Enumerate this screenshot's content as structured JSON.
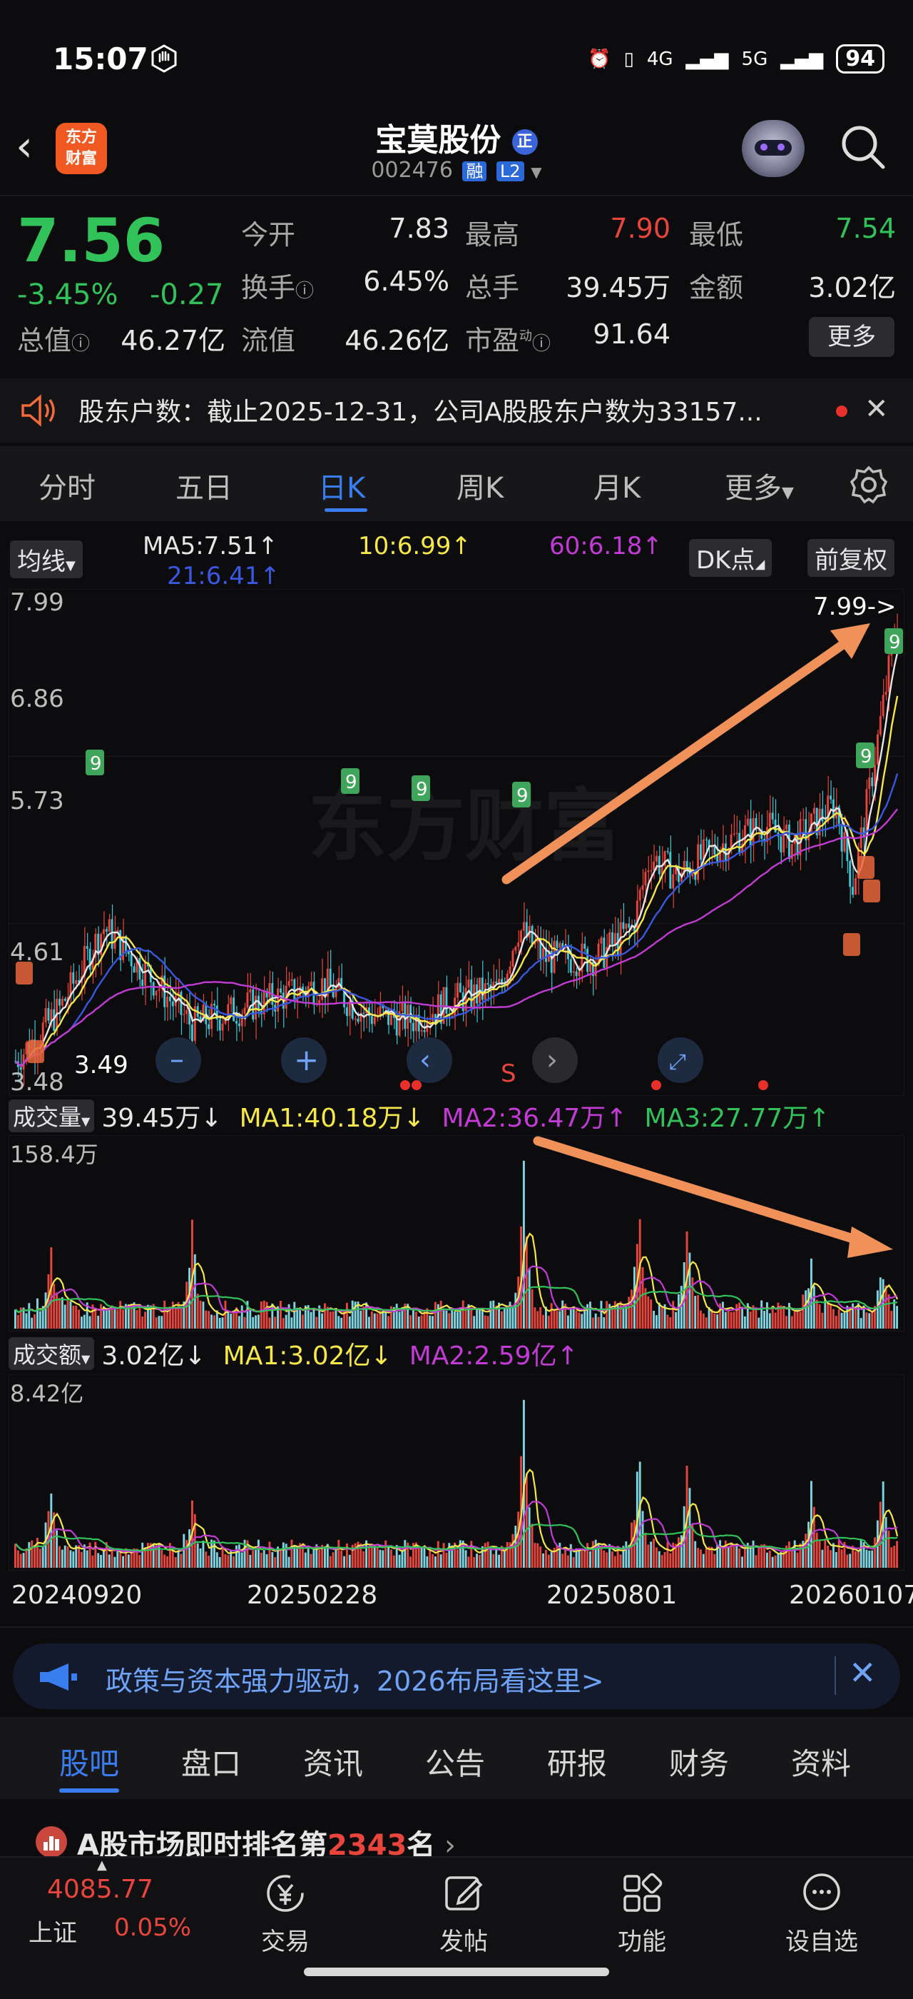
{
  "status_bar": {
    "time": "15:07",
    "network_4g": "4G",
    "network_5g": "5G",
    "battery": "94"
  },
  "header": {
    "logo_text": "东方\n财富",
    "stock_name": "宝莫股份",
    "stock_badge": "正",
    "stock_code": "002476",
    "tag_margin": "融",
    "tag_level": "L2"
  },
  "quote": {
    "price": "7.56",
    "change_pct": "-3.45%",
    "change_abs": "-0.27",
    "fields": [
      {
        "label": "今开",
        "value": "7.83",
        "color": "#e6e6e6"
      },
      {
        "label": "最高",
        "value": "7.90",
        "color": "#e8453c"
      },
      {
        "label": "最低",
        "value": "7.54",
        "color": "#31c25a"
      },
      {
        "label": "换手",
        "value": "6.45%",
        "color": "#e6e6e6"
      },
      {
        "label": "总手",
        "value": "39.45万",
        "color": "#e6e6e6"
      },
      {
        "label": "金额",
        "value": "3.02亿",
        "color": "#e6e6e6"
      },
      {
        "label": "总值",
        "value": "46.27亿",
        "color": "#e6e6e6"
      },
      {
        "label": "流值",
        "value": "46.26亿",
        "color": "#e6e6e6"
      },
      {
        "label": "市盈",
        "value": "91.64",
        "color": "#e6e6e6"
      }
    ],
    "pe_sup": "动",
    "more_label": "更多"
  },
  "notice": {
    "text": "股东户数：截止2025-12-31，公司A股股东户数为33157..."
  },
  "period_tabs": [
    "分时",
    "五日",
    "日K",
    "周K",
    "月K",
    "更多"
  ],
  "active_period": "日K",
  "ma_legend": {
    "selector": "均线",
    "ma5": "MA5:7.51↑",
    "ma10": "10:6.99↑",
    "ma60": "60:6.18↑",
    "ma21": "21:6.41↑",
    "dk_label": "DK点",
    "adjust_label": "前复权"
  },
  "colors": {
    "ma5": "#e6e6e6",
    "ma10": "#f6e84a",
    "ma21": "#3a57e0",
    "ma60": "#c23bd4",
    "up": "#e8453c",
    "down": "#31c25a",
    "arrow": "#f0915a",
    "accent": "#3a7df0"
  },
  "kchart": {
    "y_labels": [
      "7.99",
      "6.86",
      "5.73",
      "4.61",
      "3.48"
    ],
    "max_label": "7.99->",
    "min_label": "3.49",
    "watermark": "东方财富",
    "signal_s": "S",
    "nine_label": "9"
  },
  "volume": {
    "selector": "成交量",
    "current": "39.45万↓",
    "ma1": "MA1:40.18万↓",
    "ma2": "MA2:36.47万↑",
    "ma3": "MA3:27.77万↑",
    "max_label": "158.4万"
  },
  "amount": {
    "selector": "成交额",
    "current": "3.02亿↓",
    "ma1": "MA1:3.02亿↓",
    "ma2": "MA2:2.59亿↑",
    "max_label": "8.42亿"
  },
  "dates": [
    "20240920",
    "20250228",
    "20250801",
    "20260107"
  ],
  "banner": {
    "text": "政策与资本强力驱动，2026布局看这里>"
  },
  "bottom_tabs": [
    "股吧",
    "盘口",
    "资讯",
    "公告",
    "研报",
    "财务",
    "资料"
  ],
  "active_bottom_tab": "股吧",
  "rank": {
    "prefix": "A股市场即时排名第",
    "number": "2343",
    "suffix": "名"
  },
  "footer": {
    "index_value": "4085.77",
    "index_name": "上证",
    "index_pct": "0.05%",
    "items": [
      "交易",
      "发帖",
      "功能",
      "设自选"
    ]
  }
}
